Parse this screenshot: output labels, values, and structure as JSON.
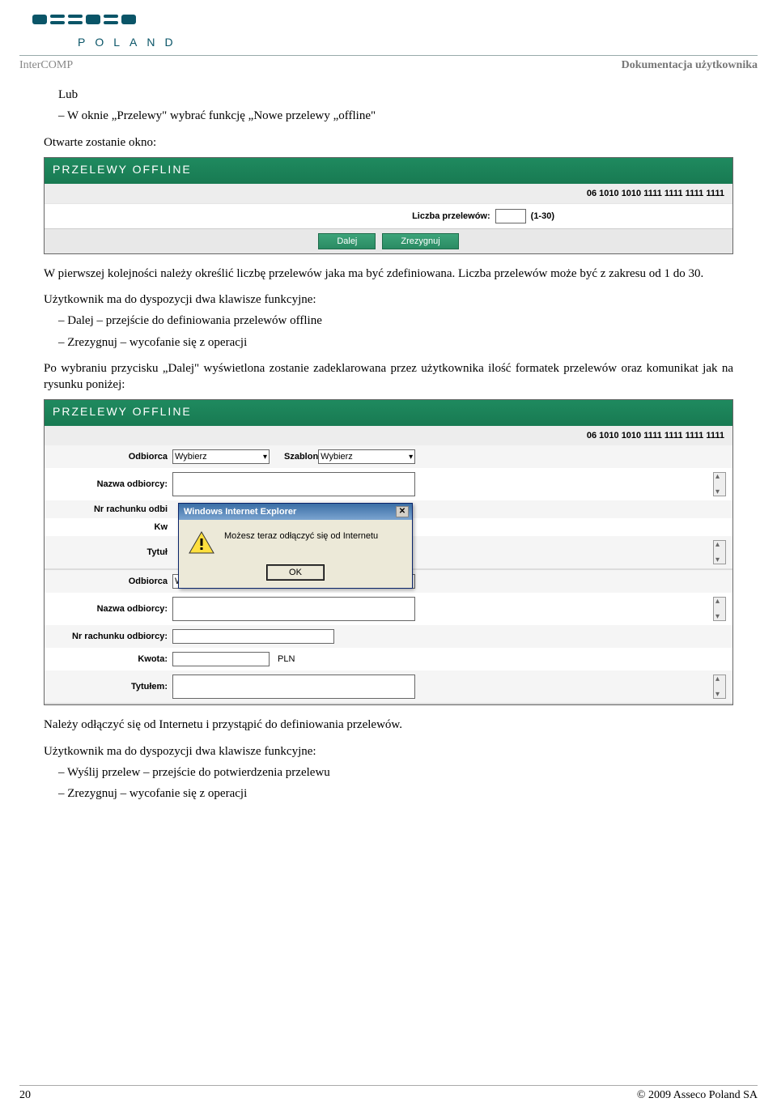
{
  "logo": {
    "brand": "asseco",
    "sub": "POLAND"
  },
  "header": {
    "left": "InterCOMP",
    "right": "Dokumentacja użytkownika"
  },
  "text": {
    "lub": "Lub",
    "bullet1": "W oknie „Przelewy\" wybrać funkcję „Nowe przelewy „offline\"",
    "otwarte": "Otwarte zostanie okno:",
    "para1": "W pierwszej kolejności należy określić liczbę przelewów jaka ma być zdefiniowana. Liczba przelewów może być z zakresu od 1 do 30.",
    "para2": "Użytkownik ma do dyspozycji dwa klawisze funkcyjne:",
    "b2a": "Dalej – przejście do definiowania przelewów offline",
    "b2b": "Zrezygnuj – wycofanie się z operacji",
    "para3": "Po wybraniu przycisku „Dalej\" wyświetlona zostanie zadeklarowana przez użytkownika ilość formatek przelewów oraz komunikat jak na rysunku poniżej:",
    "para4": "Należy odłączyć się od Internetu i przystąpić do definiowania przelewów.",
    "para5": "Użytkownik ma do dyspozycji dwa klawisze funkcyjne:",
    "b5a": "Wyślij przelew – przejście do potwierdzenia przelewu",
    "b5b": "Zrezygnuj – wycofanie się z operacji"
  },
  "shot1": {
    "title": "PRZELEWY OFFLINE",
    "account": "06 1010 1010 1111 1111 1111 1111",
    "count_label": "Liczba przelewów:",
    "count_hint": "(1-30)",
    "btn_next": "Dalej",
    "btn_cancel": "Zrezygnuj"
  },
  "shot2": {
    "title": "PRZELEWY OFFLINE",
    "account": "06 1010 1010 1111 1111 1111 1111",
    "labels": {
      "odbiorca": "Odbiorca",
      "szablon": "Szablon",
      "wybierz": "Wybierz",
      "nazwa": "Nazwa odbiorcy:",
      "nr": "Nr rachunku odbiorcy:",
      "nr_short": "Nr rachunku odbi",
      "kwota": "Kwota:",
      "kwota_short": "Kw",
      "pln": "PLN",
      "tytul": "Tytułem:",
      "tytul_short": "Tytuł"
    }
  },
  "dialog": {
    "title": "Windows Internet Explorer",
    "msg": "Możesz teraz odłączyć się od Internetu",
    "ok": "OK"
  },
  "footer": {
    "page": "20",
    "copy": "© 2009 Asseco Poland SA"
  }
}
